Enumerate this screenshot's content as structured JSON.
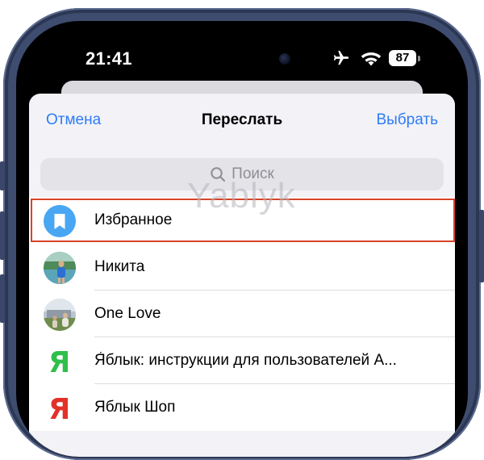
{
  "status": {
    "time": "21:41",
    "battery": "87",
    "icons": [
      "airplane-icon",
      "wifi-icon",
      "battery-icon"
    ]
  },
  "sheet": {
    "cancel": "Отмена",
    "title": "Переслать",
    "select": "Выбрать",
    "search_placeholder": "Поиск"
  },
  "chats": [
    {
      "name": "Избранное",
      "avatar": "saved-messages-bookmark-icon",
      "highlighted": true
    },
    {
      "name": "Никита",
      "avatar": "photo-avatar"
    },
    {
      "name": "One Love",
      "avatar": "photo-avatar"
    },
    {
      "name": "Я́блык: инструкции для пользователей A...",
      "avatar": "yablyk-letter-icon"
    },
    {
      "name": "Яблык Шоп",
      "avatar": "yablyk-letter-icon"
    }
  ],
  "watermark": "Yablyk",
  "colors": {
    "accent": "#2f7cf6",
    "highlight": "#d7432a",
    "frame": "#3e4c6f",
    "saved_avatar": "#49a6f3",
    "ya_green": "#2fbf4a",
    "ya_red": "#e3312a"
  }
}
